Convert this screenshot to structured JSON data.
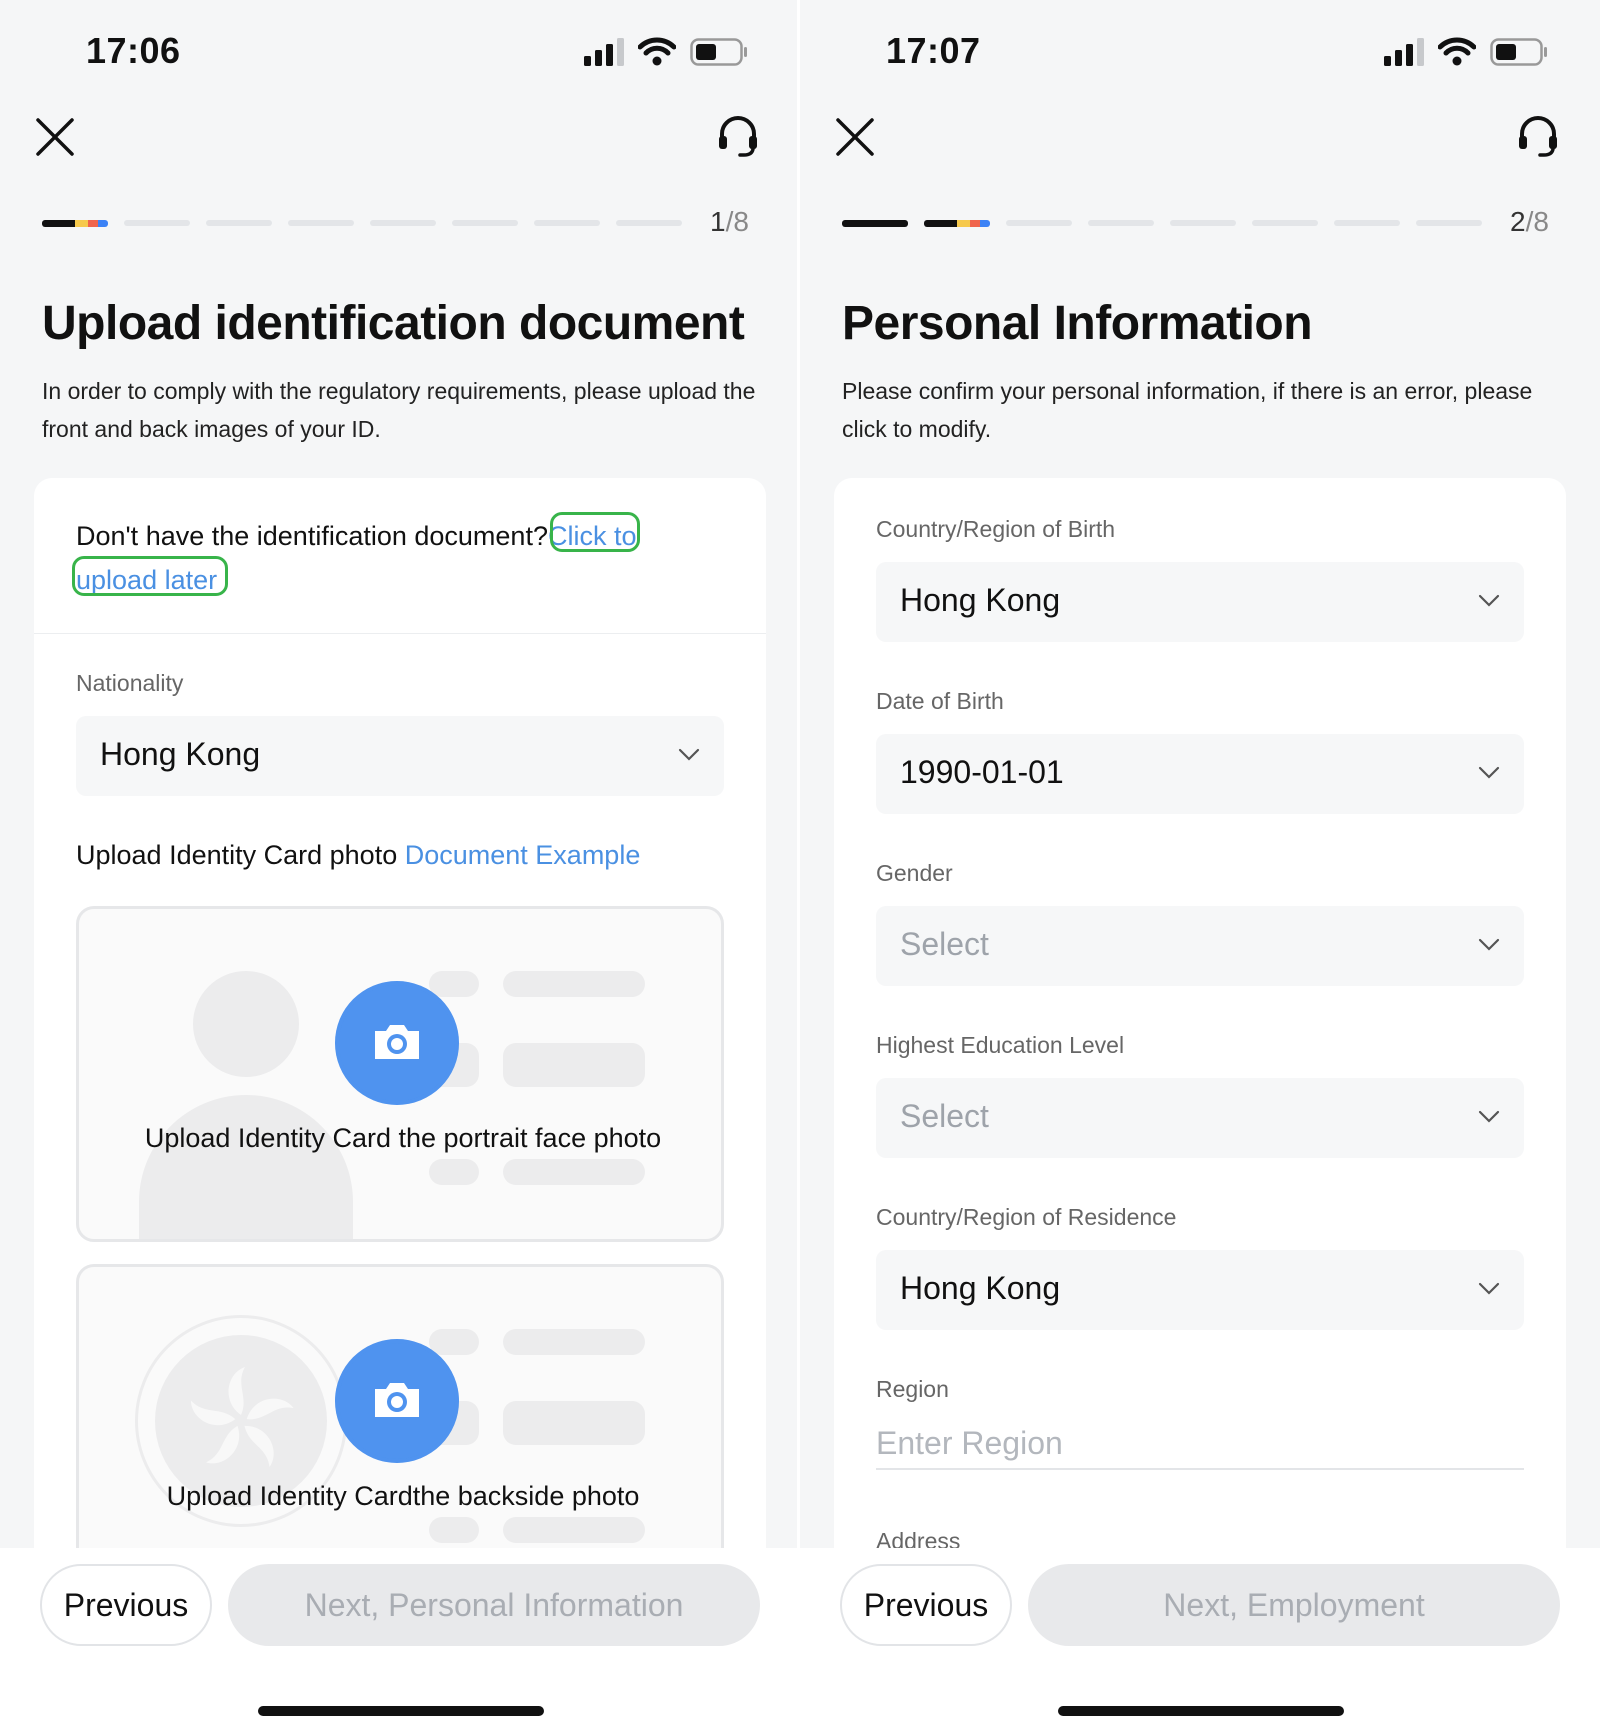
{
  "left": {
    "status": {
      "time": "17:06"
    },
    "progress": {
      "current": 1,
      "total": "8",
      "current_label": "1",
      "separator": "/"
    },
    "title": "Upload identification document",
    "description": "In order to comply with the regulatory requirements, please upload the front and back images of your ID.",
    "no_document": {
      "question": "Don't have the identification document?",
      "link": "Click to upload later"
    },
    "nationality": {
      "label": "Nationality",
      "value": "Hong Kong"
    },
    "upload": {
      "title": "Upload Identity Card photo",
      "example_link": "Document Example",
      "front_label": "Upload Identity Card the portrait face photo",
      "back_label": "Upload Identity Cardthe backside photo"
    },
    "buttons": {
      "previous": "Previous",
      "next": "Next, Personal Information"
    }
  },
  "right": {
    "status": {
      "time": "17:07"
    },
    "progress": {
      "current": 2,
      "total": "8",
      "current_label": "2",
      "separator": "/"
    },
    "title": "Personal Information",
    "description": "Please confirm your personal information, if there is an error, please click to modify.",
    "fields": {
      "birth_country": {
        "label": "Country/Region of Birth",
        "value": "Hong Kong"
      },
      "dob": {
        "label": "Date of Birth",
        "value": "1990-01-01"
      },
      "gender": {
        "label": "Gender",
        "placeholder": "Select"
      },
      "education": {
        "label": "Highest Education Level",
        "placeholder": "Select"
      },
      "residence": {
        "label": "Country/Region of Residence",
        "value": "Hong Kong"
      },
      "region": {
        "label": "Region",
        "placeholder": "Enter Region"
      },
      "address": {
        "label": "Address"
      }
    },
    "buttons": {
      "previous": "Previous",
      "next": "Next, Employment"
    }
  },
  "colors": {
    "link": "#4a90e2",
    "camera": "#4f93ef",
    "highlight": "#38b44a",
    "progress_done": "#111111"
  },
  "icons": [
    "signal-icon",
    "wifi-icon",
    "battery-icon",
    "close-icon",
    "headset-icon",
    "chevron-down-icon",
    "camera-icon"
  ]
}
